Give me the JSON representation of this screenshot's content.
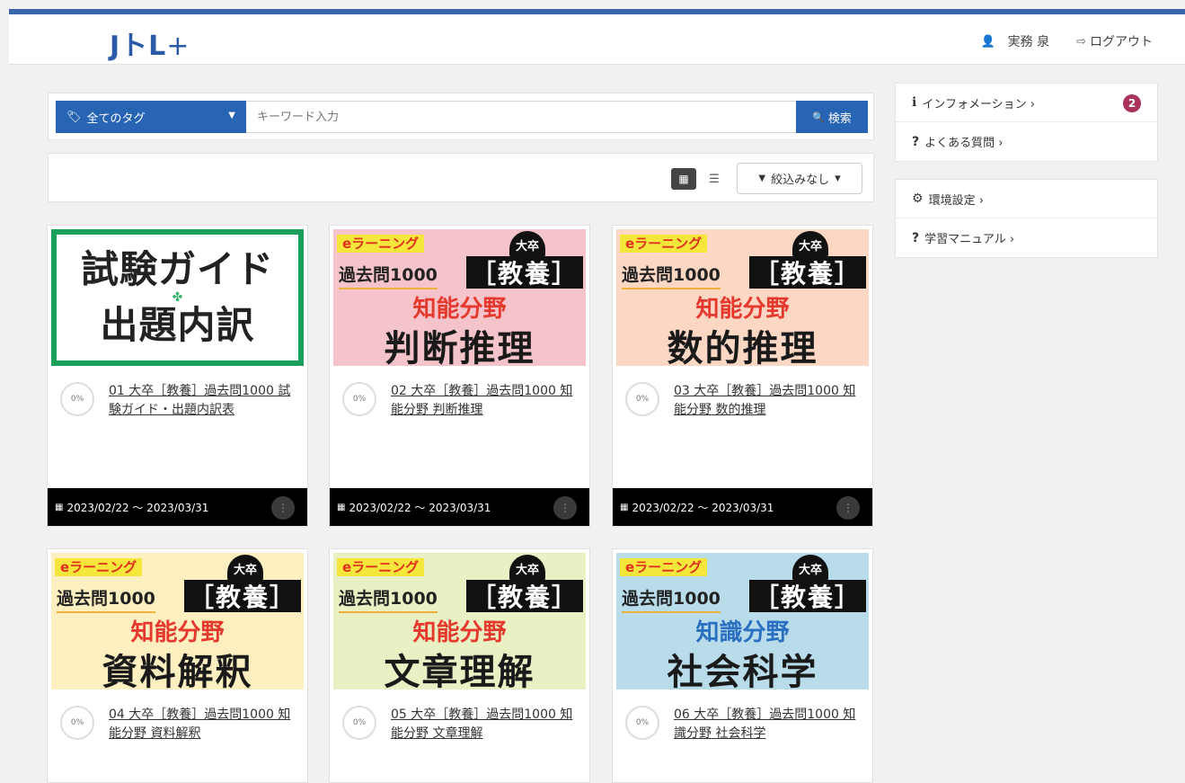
{
  "header": {
    "logo_main": "JトL",
    "logo_plus": "+",
    "user_icon": "👤",
    "user_name": "実務 泉",
    "logout_icon": "⇨",
    "logout_label": "ログアウト"
  },
  "search": {
    "tag_icon": "🏷",
    "tag_label": "全てのタグ",
    "tag_caret": "▼",
    "placeholder": "キーワード入力",
    "button_icon": "🔍",
    "button_label": "検索"
  },
  "filter": {
    "grid_icon": "▦",
    "list_icon": "☰",
    "filter_icon": "▼",
    "filter_label": "絞込みなし",
    "filter_caret": "▾"
  },
  "side_top": [
    {
      "icon": "ℹ",
      "label": "インフォメーション ›",
      "badge": "2"
    },
    {
      "icon": "?",
      "label": "よくある質問 ›"
    }
  ],
  "side_bottom": [
    {
      "icon": "⚙",
      "label": "環境設定 ›"
    },
    {
      "icon": "?",
      "label": "学習マニュアル ›"
    }
  ],
  "thumb_common": {
    "elearning": "eラーニング",
    "daisotsu": "大卒",
    "past": "過去問1000",
    "kyoyo": "［教養］"
  },
  "cards": [
    {
      "guide_line1": "試験ガイド",
      "guide_clover": "✤",
      "guide_line2": "出題内訳",
      "progress": "0%",
      "title": "01 大卒［教養］過去問1000 試験ガイド・出題内訳表",
      "date": "2023/02/22 ～ 2023/03/31",
      "color": "#ffffff"
    },
    {
      "field": "知能分野",
      "subject": "判断推理",
      "progress": "0%",
      "title": "02 大卒［教養］過去問1000 知能分野 判断推理",
      "date": "2023/02/22 ～ 2023/03/31",
      "color": "#f5c4cb"
    },
    {
      "field": "知能分野",
      "subject": "数的推理",
      "progress": "0%",
      "title": "03 大卒［教養］過去問1000 知能分野 数的推理",
      "date": "2023/02/22 ～ 2023/03/31",
      "color": "#fbd7c4"
    },
    {
      "field": "知能分野",
      "subject": "資料解釈",
      "progress": "0%",
      "title": "04 大卒［教養］過去問1000 知能分野 資料解釈",
      "color": "#fdefc0"
    },
    {
      "field": "知能分野",
      "subject": "文章理解",
      "progress": "0%",
      "title": "05 大卒［教養］過去問1000 知能分野 文章理解",
      "color": "#e9f0c3"
    },
    {
      "field": "知識分野",
      "subject": "社会科学",
      "progress": "0%",
      "title": "06 大卒［教養］過去問1000 知識分野 社会科学",
      "color": "#b9dceb"
    }
  ],
  "icons": {
    "calendar": "▦",
    "menu": "⋮"
  }
}
